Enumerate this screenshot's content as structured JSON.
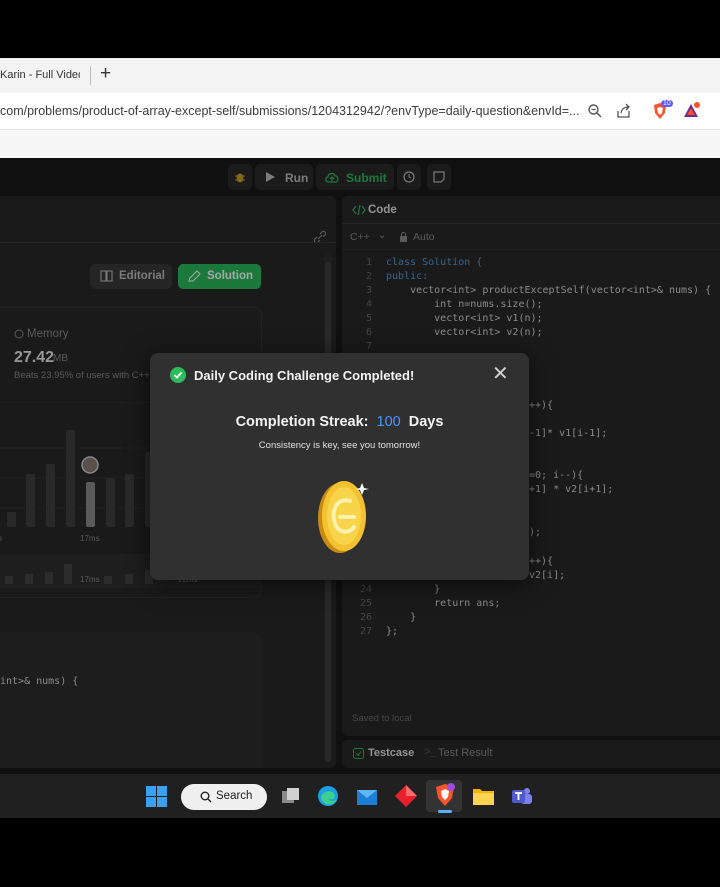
{
  "browser": {
    "tab_title": "Karin - Full Video",
    "url": "com/problems/product-of-array-except-self/submissions/1204312942/?envType=daily-question&envId=...",
    "brave_badge": "10"
  },
  "toolbar": {
    "run_label": "Run",
    "submit_label": "Submit"
  },
  "left_panel": {
    "editorial_label": "Editorial",
    "solution_label": "Solution",
    "memory_label": "Memory",
    "memory_value": "27.42",
    "memory_unit": "MB",
    "beats_text": "Beats 23.95% of users with C++",
    "axis_label_1": "17ms",
    "axis_label_2": "17ms",
    "axis_label_3": "22ms",
    "code_snippet": "int>& nums) {"
  },
  "code_panel": {
    "title": "Code",
    "language": "C++",
    "auto_label": "Auto",
    "saved_text": "Saved to local",
    "lines": [
      {
        "n": "1",
        "text": "class Solution {"
      },
      {
        "n": "2",
        "text": "public:"
      },
      {
        "n": "3",
        "text": "    vector<int> productExceptSelf(vector<int>& nums) {"
      },
      {
        "n": "4",
        "text": "        int n=nums.size();"
      },
      {
        "n": "5",
        "text": "        vector<int> v1(n);"
      },
      {
        "n": "6",
        "text": "        vector<int> v2(n);"
      },
      {
        "n": "7",
        "text": ""
      }
    ],
    "frag_1": "++){",
    "frag_2": "-1]* v1[i-1];",
    "frag_3": "=0; i--){",
    "frag_4": "+1] * v2[i+1];",
    "frag_5": ");",
    "frag_6": "++){",
    "frag_7": "v2[i];",
    "tail_lines": [
      {
        "n": "24",
        "text": "        }"
      },
      {
        "n": "25",
        "text": "        return ans;"
      },
      {
        "n": "26",
        "text": "    }"
      },
      {
        "n": "27",
        "text": "};"
      }
    ]
  },
  "bottom_tabs": {
    "testcase_label": "Testcase",
    "result_label": "Test Result"
  },
  "modal": {
    "title": "Daily Coding Challenge Completed!",
    "streak_label": "Completion Streak:",
    "streak_value": "100",
    "streak_unit": "Days",
    "message": "Consistency is key, see you tomorrow!"
  },
  "taskbar": {
    "search_label": "Search"
  },
  "colors": {
    "accent_green": "#2cbb5d",
    "streak_blue": "#3c9cff",
    "coin_gold": "#f2c230"
  }
}
